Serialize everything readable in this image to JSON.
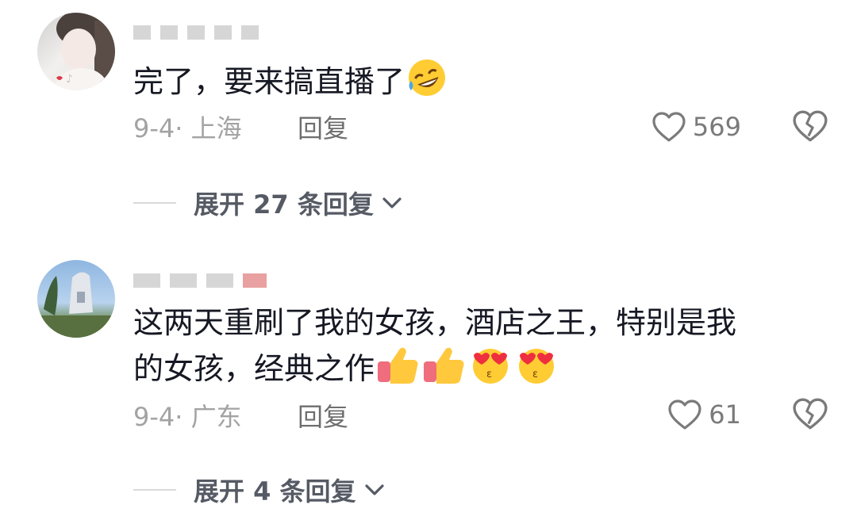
{
  "comments": [
    {
      "text": "完了，要来搞直播了",
      "date_location": "9-4· 上海",
      "reply_label": "回复",
      "likes": "569",
      "expand_label": "展开 27 条回复"
    },
    {
      "text_line1": "这两天重刷了我的女孩，酒店之王，特别是我",
      "text_line2": "的女孩，经典之作",
      "date_location": "9-4· 广东",
      "reply_label": "回复",
      "likes": "61",
      "expand_label": "展开 4 条回复"
    }
  ],
  "icons": {
    "like": "heart-outline-icon",
    "dislike": "broken-heart-icon",
    "expand": "chevron-down-icon",
    "emoji_laugh": "rolling-on-floor-laughing-emoji",
    "emoji_thumb": "thumbs-up-emoji",
    "emoji_kiss": "heart-eyes-kiss-emoji"
  },
  "colors": {
    "text": "#161823",
    "meta": "#a3a3a3",
    "expand": "#555a64",
    "icon": "#7a7a7a"
  }
}
